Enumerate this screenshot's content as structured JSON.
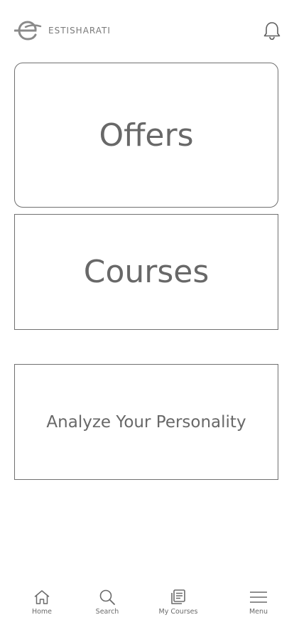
{
  "header": {
    "brand": "ESTISHARATI",
    "logo_icon": "estisharati-logo",
    "notification_icon": "bell-icon"
  },
  "cards": {
    "offers": "Offers",
    "courses": "Courses",
    "analyze": "Analyze Your Personality"
  },
  "bottom_nav": {
    "items": [
      {
        "label": "Home",
        "icon": "home-icon"
      },
      {
        "label": "Search",
        "icon": "search-icon"
      },
      {
        "label": "My Courses",
        "icon": "book-icon"
      },
      {
        "label": "Menu",
        "icon": "menu-icon"
      }
    ]
  },
  "colors": {
    "text": "#666666",
    "border": "#707070",
    "background": "#ffffff"
  }
}
